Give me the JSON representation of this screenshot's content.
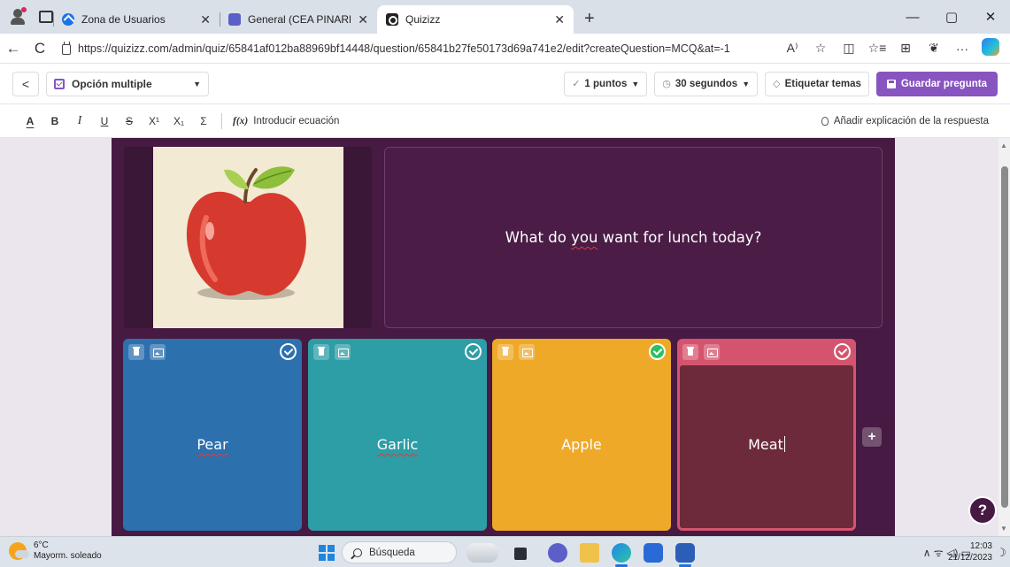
{
  "browser": {
    "tabs": [
      {
        "title": "Zona de Usuarios"
      },
      {
        "title": "General (CEA PINARES: VÍDEO Y"
      },
      {
        "title": "Quizizz"
      }
    ],
    "tab_close": "✕",
    "new_tab": "+",
    "url": "https://quizizz.com/admin/quiz/65841af012ba88969bf14448/question/65841b27fe50173d69a741e2/edit?createQuestion=MCQ&at=-1",
    "window_controls": {
      "minimize": "—",
      "restore": "▢",
      "close": "✕"
    },
    "nav": {
      "back": "←",
      "refresh": "C"
    },
    "address_icons": {
      "read_aloud": "A⁾",
      "favorite": "☆",
      "split": "◫",
      "favorites": "☆≡",
      "collections": "⊞",
      "extensions": "❦",
      "more": "···"
    }
  },
  "editor": {
    "back": "<",
    "question_type": "Opción multiple",
    "points": "1 puntos",
    "time": "30 segundos",
    "tag_topics": "Etiquetar temas",
    "save": "Guardar pregunta",
    "format": {
      "text_color": "A",
      "bold": "B",
      "italic": "I",
      "underline": "U",
      "strike": "S",
      "superscript": "X¹",
      "subscript": "X₁",
      "symbol": "Σ"
    },
    "equation_prefix": "f(x)",
    "equation": "Introducir ecuación",
    "add_explanation": "Añadir explicación de la respuesta"
  },
  "question": {
    "prefix": "What do ",
    "misspelled": "you",
    "suffix": " want for lunch today?",
    "options": [
      {
        "label": "Pear",
        "correct": false,
        "color": "#2d70ae"
      },
      {
        "label": "Garlic",
        "correct": false,
        "color": "#2d9da6"
      },
      {
        "label": "Apple",
        "correct": true,
        "color": "#efa929"
      },
      {
        "label": "Meat",
        "correct": false,
        "color": "#d5546d"
      }
    ],
    "add_option": "+",
    "help": "?"
  },
  "taskbar": {
    "temperature": "6°C",
    "weather": "Mayorm. soleado",
    "search": "Búsqueda",
    "tray": "∧  ᯤ  ◁)  ▭",
    "time": "12:03",
    "date": "21/12/2023",
    "night": "☽"
  }
}
